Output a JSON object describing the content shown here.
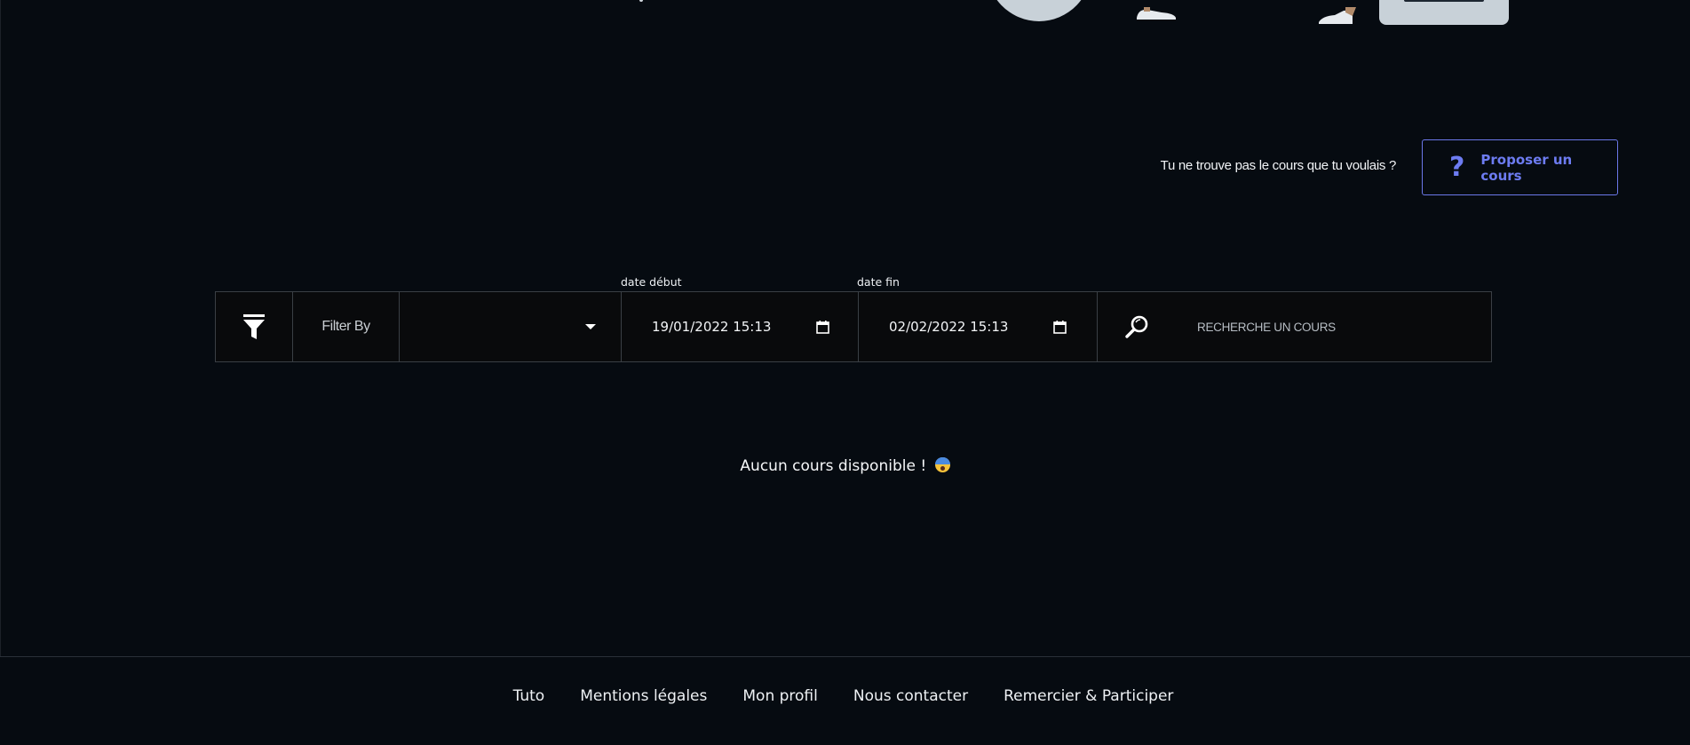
{
  "propose": {
    "question": "Tu ne trouve pas le cours que tu voulais ?",
    "button_icon": "?",
    "button_label": "Proposer un cours"
  },
  "filters": {
    "filter_icon": "filter-icon",
    "filter_by_label": "Filter By",
    "select_value": "",
    "start_label": "date début",
    "start_value": "19/01/2022 15:13",
    "end_label": "date fin",
    "end_value": "02/02/2022 15:13",
    "search_icon": "search-icon",
    "search_placeholder": "RECHERCHE UN COURS"
  },
  "empty_state": {
    "message": "Aucun cours disponible !",
    "emoji": "😨"
  },
  "footer": {
    "links": [
      "Tuto",
      "Mentions légales",
      "Mon profil",
      "Nous contacter",
      "Remercier & Participer"
    ]
  },
  "colors": {
    "background": "#060b11",
    "accent": "#6d7cf2",
    "border": "#3a3f45"
  }
}
